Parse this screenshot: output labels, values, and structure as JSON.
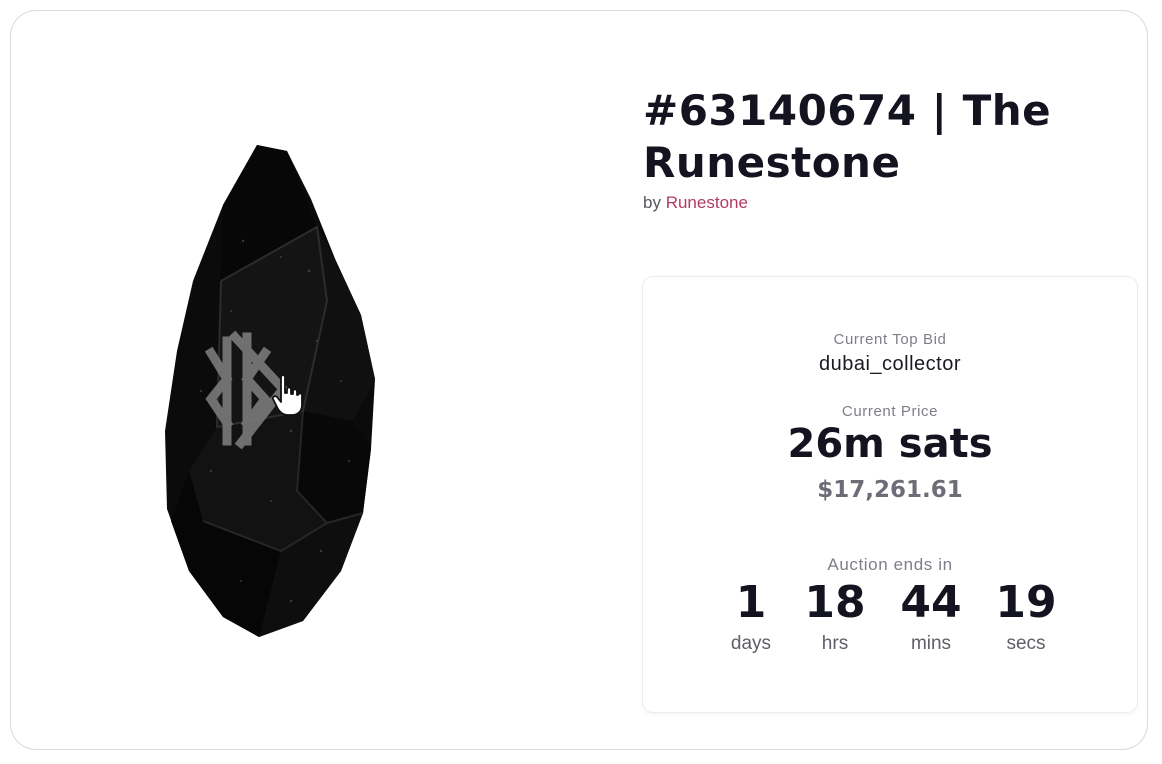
{
  "item": {
    "title": "#63140674 | The Runestone",
    "by_prefix": "by",
    "creator": "Runestone"
  },
  "auction": {
    "top_bid_label": "Current Top Bid",
    "top_bidder": "dubai_collector",
    "price_label": "Current Price",
    "price_sats": "26m sats",
    "price_usd": "$17,261.61",
    "ends_label": "Auction ends in",
    "countdown": [
      {
        "value": "1",
        "unit": "days"
      },
      {
        "value": "18",
        "unit": "hrs"
      },
      {
        "value": "44",
        "unit": "mins"
      },
      {
        "value": "19",
        "unit": "secs"
      }
    ]
  },
  "icons": {
    "artwork": "runestone-obsidian-artwork",
    "cursor": "hand-pointer-icon"
  },
  "colors": {
    "creator_link": "#b23a66",
    "text_primary": "#141420",
    "text_muted": "#7e7e88"
  }
}
